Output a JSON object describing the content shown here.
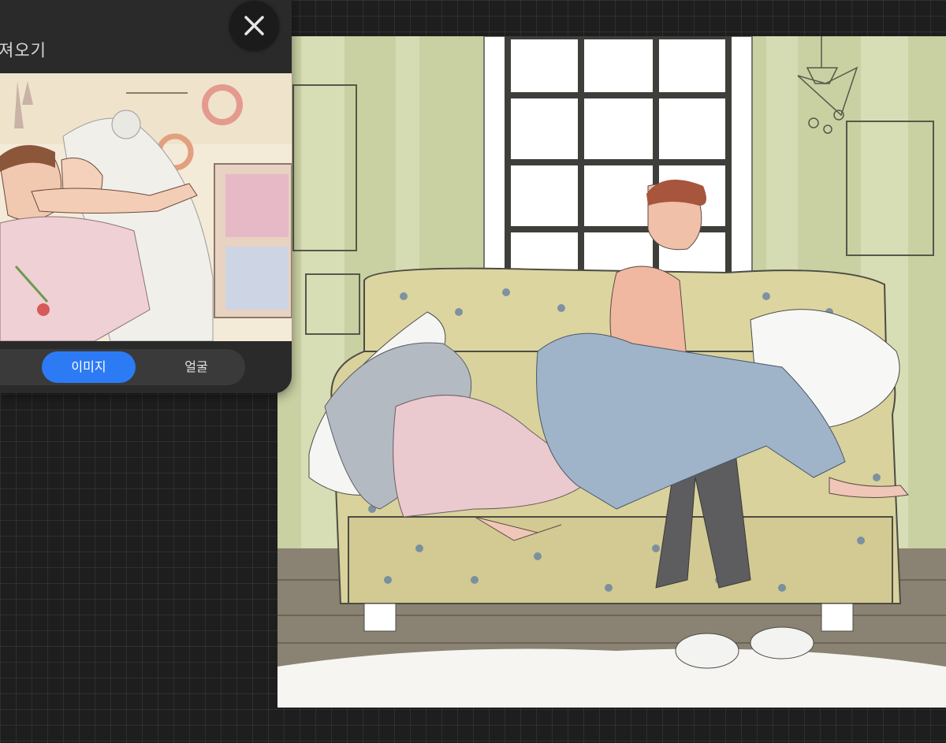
{
  "reference": {
    "title": "져오기",
    "close_icon": "close-icon",
    "tabs": [
      {
        "label": "이미지",
        "active": true
      },
      {
        "label": "얼굴",
        "active": false
      }
    ]
  },
  "theme": {
    "background": "#1e1e1e",
    "panel": "#2a2a2a",
    "accent": "#2c7bf5"
  }
}
